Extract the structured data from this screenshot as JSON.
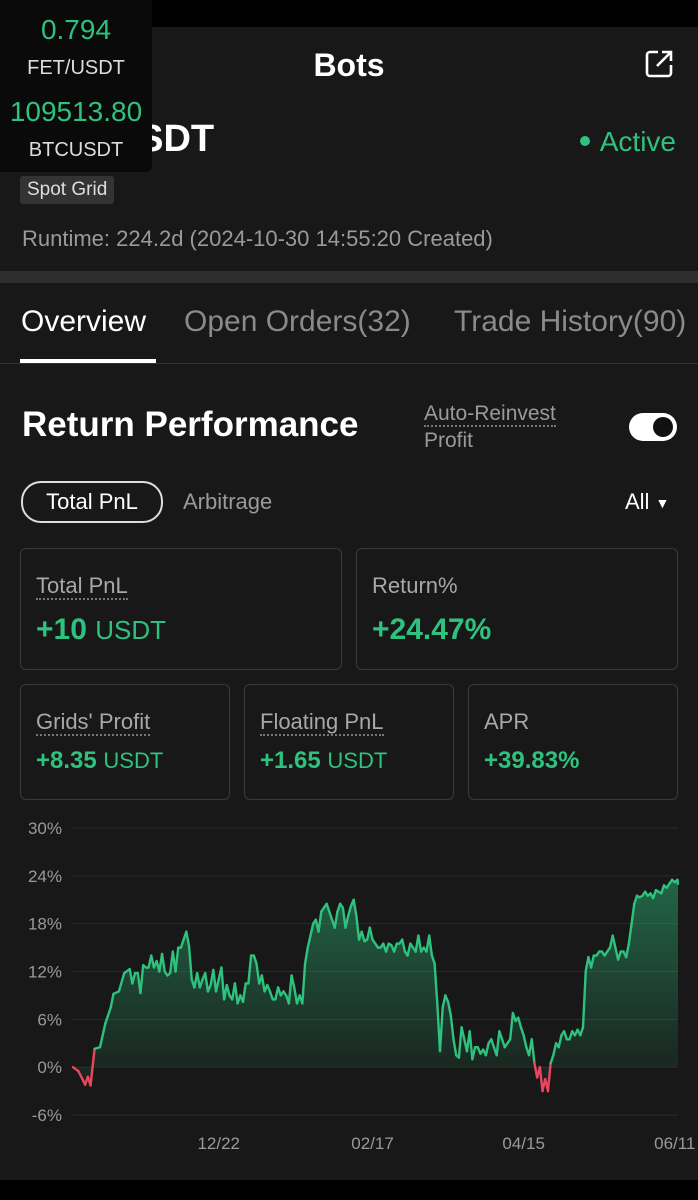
{
  "header": {
    "title": "Bots",
    "back_icon": "back-arrow-icon",
    "share_icon": "share-external-icon"
  },
  "ticker": [
    {
      "price": "0.794",
      "symbol": "FET/USDT"
    },
    {
      "price": "109513.80",
      "symbol": "BTCUSDT"
    }
  ],
  "bot": {
    "pair": "BTC/USDT",
    "status": "Active",
    "strategy": "Spot Grid",
    "runtime": "Runtime: 224.2d (2024-10-30 14:55:20 Created)"
  },
  "tabs": [
    {
      "label": "Overview",
      "active": true
    },
    {
      "label": "Open Orders(32)",
      "active": false
    },
    {
      "label": "Trade History(90)",
      "active": false
    }
  ],
  "performance": {
    "title": "Return Performance",
    "reinvest_line1": "Auto-Reinvest",
    "reinvest_line2": "Profit",
    "reinvest_on": true,
    "pill_total": "Total PnL",
    "pill_arbitrage": "Arbitrage",
    "filter": "All"
  },
  "stats": {
    "total_pnl": {
      "label": "Total PnL",
      "value": "+10",
      "unit": "USDT"
    },
    "return_pct": {
      "label": "Return%",
      "value": "+24.47%"
    },
    "grids_profit": {
      "label": "Grids' Profit",
      "value": "+8.35",
      "unit": "USDT"
    },
    "floating_pnl": {
      "label": "Floating PnL",
      "value": "+1.65",
      "unit": "USDT"
    },
    "apr": {
      "label": "APR",
      "value": "+39.83%"
    }
  },
  "colors": {
    "positive": "#2ec27e",
    "negative": "#e8475f",
    "background": "#181818"
  },
  "chart_data": {
    "type": "area",
    "y_tick_labels": [
      "30%",
      "24%",
      "18%",
      "12%",
      "6%",
      "0%",
      "-6%"
    ],
    "y_ticks": [
      30,
      24,
      18,
      12,
      6,
      0,
      -6
    ],
    "ylim": [
      -6,
      30
    ],
    "x_tick_labels": [
      "12/22",
      "02/17",
      "04/15",
      "06/11"
    ],
    "x_ticks": [
      54,
      111,
      167,
      223
    ],
    "xlim": [
      0,
      224.2
    ],
    "grid": true,
    "x": [
      0,
      2,
      3.5,
      4.5,
      5.5,
      6.5,
      8,
      10,
      12,
      14,
      15,
      17,
      19,
      21,
      22,
      23,
      24,
      25,
      26,
      27,
      28,
      29,
      30,
      31,
      32,
      33,
      34,
      35,
      36,
      37,
      38,
      39,
      40,
      41,
      42,
      43,
      44,
      45,
      46,
      47,
      48,
      49,
      50,
      51,
      52,
      53,
      54,
      55,
      56,
      57,
      58,
      59,
      60,
      61,
      62,
      63,
      64,
      65,
      66,
      67,
      68,
      69,
      70,
      71,
      72,
      73,
      74,
      75,
      76,
      77,
      78,
      79,
      80,
      81,
      82,
      83,
      84,
      85,
      86,
      87,
      88,
      89,
      90,
      91,
      92,
      93,
      94,
      95,
      96,
      97,
      98,
      99,
      100,
      101,
      102,
      103,
      104,
      105,
      106,
      107,
      108,
      109,
      110,
      111,
      112,
      113,
      114,
      115,
      116,
      117,
      118,
      119,
      120,
      121,
      122,
      123,
      124,
      125,
      126,
      127,
      128,
      129,
      130,
      131,
      132,
      133,
      134,
      135,
      136,
      137,
      138,
      139,
      140,
      141,
      142,
      143,
      144,
      145,
      146,
      147,
      148,
      149,
      150,
      151,
      152,
      153,
      154,
      155,
      156,
      157,
      158,
      159,
      160,
      161,
      162,
      163,
      164,
      165,
      166,
      167,
      168,
      169,
      170,
      171,
      172,
      173,
      174,
      175,
      176,
      177,
      178,
      179,
      180,
      181,
      182,
      183,
      184,
      185,
      186,
      187,
      188,
      189,
      190,
      191,
      192,
      193,
      194,
      195,
      196,
      197,
      198,
      199,
      200,
      201,
      202,
      203,
      204,
      205,
      206,
      207,
      208,
      209,
      210,
      211,
      212,
      213,
      214,
      215,
      216,
      217,
      218,
      219,
      220,
      221,
      222,
      223,
      224,
      224.2
    ],
    "series": [
      {
        "values": [
          0,
          -0.5,
          -1.5,
          -2.2,
          -1.2,
          -2.3,
          2.3,
          2.5,
          5.5,
          7.5,
          9.2,
          9.5,
          11.8,
          12.3,
          10.5,
          11.8,
          11.8,
          9.3,
          12.8,
          12.5,
          12.5,
          14,
          12.5,
          13.3,
          12,
          14.2,
          12,
          11.5,
          11.8,
          14.5,
          12,
          15,
          15,
          16,
          17,
          15.2,
          11,
          10,
          11.8,
          10,
          11,
          11.8,
          9.5,
          10.3,
          12.2,
          9.5,
          11,
          12.5,
          8.5,
          10.3,
          9,
          8.5,
          10.5,
          8,
          9,
          8.2,
          10.5,
          10.5,
          14,
          14,
          13,
          10.5,
          11.5,
          9.5,
          10.3,
          9.5,
          8.5,
          8.5,
          10,
          9,
          9.5,
          9,
          8,
          11.5,
          10,
          8,
          9,
          8,
          13,
          15,
          16.5,
          18,
          18.5,
          17,
          19.5,
          20,
          20.5,
          19.5,
          18.5,
          17.5,
          19.5,
          20.5,
          20,
          17.5,
          19,
          20.2,
          21,
          19,
          16,
          17,
          15.8,
          16,
          17.5,
          16,
          15.5,
          15,
          15,
          15.5,
          14.5,
          15.5,
          15.3,
          14.5,
          15.5,
          15.5,
          16,
          14.5,
          14,
          15.5,
          15,
          14.5,
          16.5,
          14.5,
          15,
          14.5,
          16.5,
          14,
          13,
          8,
          2,
          7.5,
          9,
          8.2,
          6.5,
          3.5,
          1.5,
          1.2,
          5,
          3.5,
          2,
          4.5,
          1,
          2.5,
          2.5,
          1.7,
          2.2,
          1.5,
          3,
          3.5,
          2.5,
          1.5,
          4.5,
          3.5,
          2.5,
          3,
          3.5,
          6.8,
          5.8,
          6.2,
          5,
          4,
          2.5,
          1.5,
          3.5,
          0.5,
          -1.3,
          0,
          -3,
          -1.5,
          -3,
          0.5,
          1.5,
          3,
          2.5,
          4,
          4.5,
          3.5,
          3.5,
          4.5,
          4,
          4.7,
          4,
          5,
          12,
          13.8,
          12.5,
          14,
          14,
          14.5,
          14.5,
          14,
          14.5,
          15,
          16.5,
          15,
          13.5,
          14.5,
          14.5,
          13.8,
          15.5,
          18,
          20.5,
          21.5,
          21.3,
          21.5,
          22,
          21.5,
          21.8,
          21.2,
          22.2,
          22,
          21.8,
          22.8,
          22.5,
          23,
          23.5,
          23.2,
          23.5,
          23,
          22.5,
          23,
          23.5,
          23.5,
          23.3,
          22.8,
          23.5,
          22.5,
          21.2,
          22.5,
          22,
          21,
          22.2,
          23,
          22.5,
          21.8,
          23,
          23.5,
          22.8,
          24,
          24.5,
          24.47
        ]
      }
    ]
  }
}
